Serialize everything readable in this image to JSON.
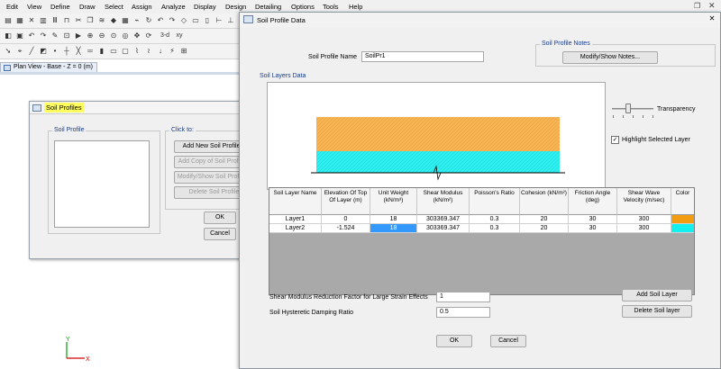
{
  "menu": [
    "Edit",
    "View",
    "Define",
    "Draw",
    "Select",
    "Assign",
    "Analyze",
    "Display",
    "Design",
    "Detailing",
    "Options",
    "Tools",
    "Help"
  ],
  "toolbar": {
    "row2_text": "3-d",
    "row2_text_b": "xy",
    "icons_row1": [
      "new-icon",
      "open-icon",
      "close-icon",
      "chart-icon",
      "bars-icon",
      "frame-icon",
      "cut-icon",
      "copy-icon",
      "layers-icon",
      "node-icon",
      "grid-icon",
      "link-icon",
      "rotate-icon",
      "undo-icon",
      "redo-icon",
      "diamond-icon",
      "select-icon",
      "deselect-icon",
      "measure-icon",
      "ruler-icon"
    ],
    "icons_row2": [
      "open-folder-icon",
      "save-icon",
      "undo-icon",
      "redo-icon",
      "pencil-icon",
      "lock-icon",
      "run-icon",
      "zoom-in-icon",
      "zoom-out-icon",
      "zoom-window-icon",
      "zoom-prev-icon",
      "pan-icon",
      "refresh-icon"
    ],
    "icons_row3": [
      "pointer-icon",
      "snap-icon",
      "draw-line-icon",
      "draw-area-icon",
      "draw-node-icon",
      "draw-frame-icon",
      "draw-brace-icon",
      "draw-beam-icon",
      "draw-wall-icon",
      "draw-slab-icon",
      "draw-opening-icon",
      "draw-link-icon",
      "draw-spring-icon",
      "draw-load-icon",
      "quick-icon",
      "grid-snap-icon"
    ]
  },
  "plan_tab": {
    "label": "Plan View - Base - Z = 0 (m)"
  },
  "axis": {
    "y": "Y",
    "x": "X"
  },
  "soil_profiles_dialog": {
    "title": "Soil Profiles",
    "soil_profile_group": "Soil Profile",
    "click_to_group": "Click to:",
    "buttons": {
      "add_new": "Add New Soil Profile...",
      "add_copy": "Add Copy of Soil Profile...",
      "modify_show": "Modify/Show Soil Profile...",
      "delete": "Delete Soil Profile"
    },
    "ok": "OK",
    "cancel": "Cancel"
  },
  "soil_profile_data": {
    "title": "Soil Profile Data",
    "profile_name_label": "Soil Profile Name",
    "profile_name_value": "SoilPr1",
    "notes_group": "Soil Profile Notes",
    "notes_button": "Modify/Show Notes...",
    "layers_group": "Soil Layers Data",
    "transparency_label": "Transparency",
    "transparency_value": 0.45,
    "highlight_label": "Highlight Selected Layer",
    "highlight_checked": true,
    "layer_colors": [
      "#f6b455",
      "#2ff0f0"
    ],
    "table": {
      "headers": [
        "Soil Layer Name",
        "Elevation Of Top Of Layer (m)",
        "Unit Weight (kN/m³)",
        "Shear Modulus (kN/m²)",
        "Poisson's Ratio",
        "Cohesion (kN/m²)",
        "Friction Angle (deg)",
        "Shear Wave Velocity (m/sec)",
        "Color"
      ],
      "rows": [
        {
          "name": "Layer1",
          "elevation": "0",
          "unit_weight": "18",
          "shear_modulus": "303369.347",
          "poisson": "0.3",
          "cohesion": "20",
          "friction": "30",
          "velocity": "300",
          "color": "#f39c12"
        },
        {
          "name": "Layer2",
          "elevation": "-1.524",
          "unit_weight": "18",
          "shear_modulus": "303369.347",
          "poisson": "0.3",
          "cohesion": "20",
          "friction": "30",
          "velocity": "300",
          "color": "#14f0f0"
        }
      ]
    },
    "shear_factor_label": "Shear Modulus Reduction Factor for Large Strain Effects",
    "shear_factor_value": "1",
    "damping_label": "Soil Hysteretic Damping Ratio",
    "damping_value": "0.5",
    "add_layer": "Add Soil Layer",
    "delete_layer": "Delete Soil layer",
    "ok": "OK",
    "cancel": "Cancel"
  }
}
